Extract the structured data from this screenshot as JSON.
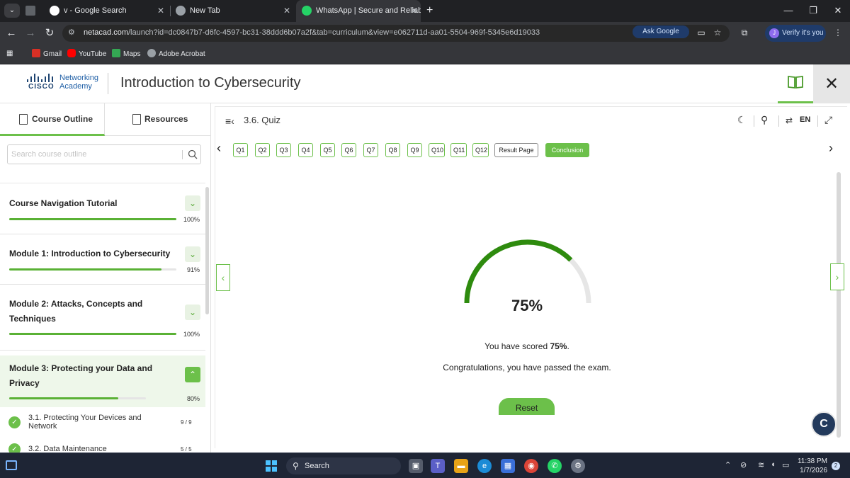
{
  "browser": {
    "tabs": [
      {
        "title": "v - Google Search",
        "active": false
      },
      {
        "title": "New Tab",
        "active": false
      },
      {
        "title": "WhatsApp | Secure and Reliable",
        "active": true
      }
    ],
    "new_tab": "+",
    "minimize": "—",
    "restore": "❐",
    "close": "✕",
    "url_host": "netacad.com",
    "url_path": "/launch?id=dc0847b7-d6fc-4597-bc31-38ddd6b07a2f&tab=curriculum&view=e062711d-aa01-5504-969f-5345e6d19033",
    "ask_google": "Ask Google",
    "verify": "Verify it's you",
    "profile_initial": "J",
    "bookmarks": [
      {
        "label": "Gmail",
        "color": "#d93025"
      },
      {
        "label": "YouTube",
        "color": "#ff0000"
      },
      {
        "label": "Maps",
        "color": "#34a853"
      },
      {
        "label": "Adobe Acrobat",
        "color": "#9aa0a6"
      }
    ]
  },
  "app": {
    "brand_line1": "Networking",
    "brand_line2": "Academy",
    "cisco_word": "CISCO",
    "course_title": "Introduction to Cybersecurity",
    "accent": "#6cc04a"
  },
  "sidebar": {
    "tab_outline": "Course Outline",
    "tab_resources": "Resources",
    "search_placeholder": "Search course outline",
    "modules": [
      {
        "title": "Course Navigation Tutorial",
        "progress": "100%",
        "fraction": 1.0,
        "expanded": false
      },
      {
        "title": "Module 1: Introduction to Cybersecurity",
        "progress": "91%",
        "fraction": 0.91,
        "expanded": false
      },
      {
        "title": "Module 2: Attacks, Concepts and Techniques",
        "progress": "100%",
        "fraction": 1.0,
        "expanded": false
      },
      {
        "title": "Module 3: Protecting your Data and Privacy",
        "progress": "80%",
        "fraction": 0.8,
        "expanded": true
      }
    ],
    "lessons": [
      {
        "title": "3.1. Protecting Your Devices and Network",
        "count": "9 / 9"
      },
      {
        "title": "3.2. Data Maintenance",
        "count": "5 / 5"
      }
    ]
  },
  "quiz": {
    "section_title": "3.6. Quiz",
    "lang": "EN",
    "questions": [
      "Q1",
      "Q2",
      "Q3",
      "Q4",
      "Q5",
      "Q6",
      "Q7",
      "Q8",
      "Q9",
      "Q10",
      "Q11",
      "Q12"
    ],
    "result_page": "Result Page",
    "conclusion": "Conclusion",
    "score": "75%",
    "score_fraction": 0.75,
    "score_prefix": "You have scored ",
    "score_suffix": ".",
    "congrats": "Congratulations, you have passed the exam.",
    "reset": "Reset"
  },
  "taskbar": {
    "search": "Search",
    "time": "11:38 PM",
    "date": "1/7/2026",
    "notifications": "2"
  }
}
